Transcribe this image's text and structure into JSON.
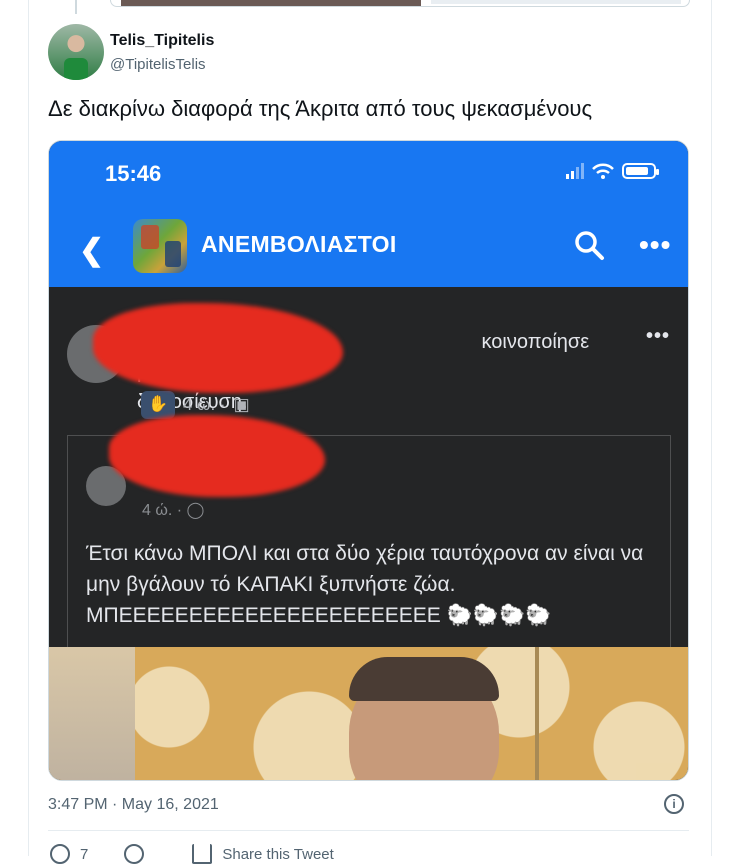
{
  "author": {
    "name": "Telis_Tipitelis",
    "handle": "@TipitelisTelis"
  },
  "tweet": {
    "text": "Δε διακρίνω διαφορά της Άκριτα από τους ψεκασμένους",
    "timestamp": "3:47 PM · May 16, 2021"
  },
  "screenshot": {
    "status_time": "15:46",
    "group_name": "ΑΝΕΜΒΟΛΙΑΣΤΟΙ",
    "shared_suffix": "κοινοποίησε μια",
    "shared_object": "δημοσίευση.",
    "share_time": "4 ώ. ·",
    "inner_time": "4 ώ. ·",
    "post_text": "Έτσι κάνω ΜΠΟΛΙ και στα δύο χέρια ταυτόχρονα αν είναι να μην βγάλουν τό ΚΑΠΑΚΙ ξυπνήστε ζώα. ΜΠΕΕΕΕΕΕΕΕΕΕΕΕΕΕΕΕΕΕΕΕΕΕΕ 🐑🐑🐑🐑"
  },
  "actions": {
    "reply_count": "7",
    "share_label": "Share this Tweet"
  },
  "icons": {
    "back": "back-chevron-icon",
    "search": "search-icon",
    "more": "more-options-icon",
    "info": "info-icon",
    "reply": "reply-icon",
    "retweet": "retweet-icon",
    "share": "share-icon"
  }
}
